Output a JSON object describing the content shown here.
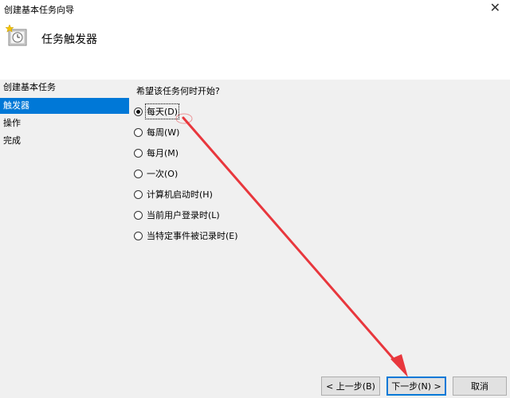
{
  "window": {
    "title": "创建基本任务向导",
    "close_glyph": "✕"
  },
  "header": {
    "title": "任务触发器",
    "icon": "clock-wizard-icon"
  },
  "sidebar": {
    "items": [
      {
        "label": "创建基本任务",
        "selected": false
      },
      {
        "label": "触发器",
        "selected": true
      },
      {
        "label": "操作",
        "selected": false
      },
      {
        "label": "完成",
        "selected": false
      }
    ]
  },
  "main": {
    "question": "希望该任务何时开始?",
    "options": [
      {
        "label": "每天(D)",
        "checked": true
      },
      {
        "label": "每周(W)",
        "checked": false
      },
      {
        "label": "每月(M)",
        "checked": false
      },
      {
        "label": "一次(O)",
        "checked": false
      },
      {
        "label": "计算机启动时(H)",
        "checked": false
      },
      {
        "label": "当前用户登录时(L)",
        "checked": false
      },
      {
        "label": "当特定事件被记录时(E)",
        "checked": false
      }
    ]
  },
  "buttons": {
    "back": "< 上一步(B)",
    "next": "下一步(N) >",
    "cancel": "取消"
  },
  "colors": {
    "selection": "#0078d7",
    "annotation_arrow": "#e8373d",
    "panel_bg": "#f0f0f0"
  }
}
